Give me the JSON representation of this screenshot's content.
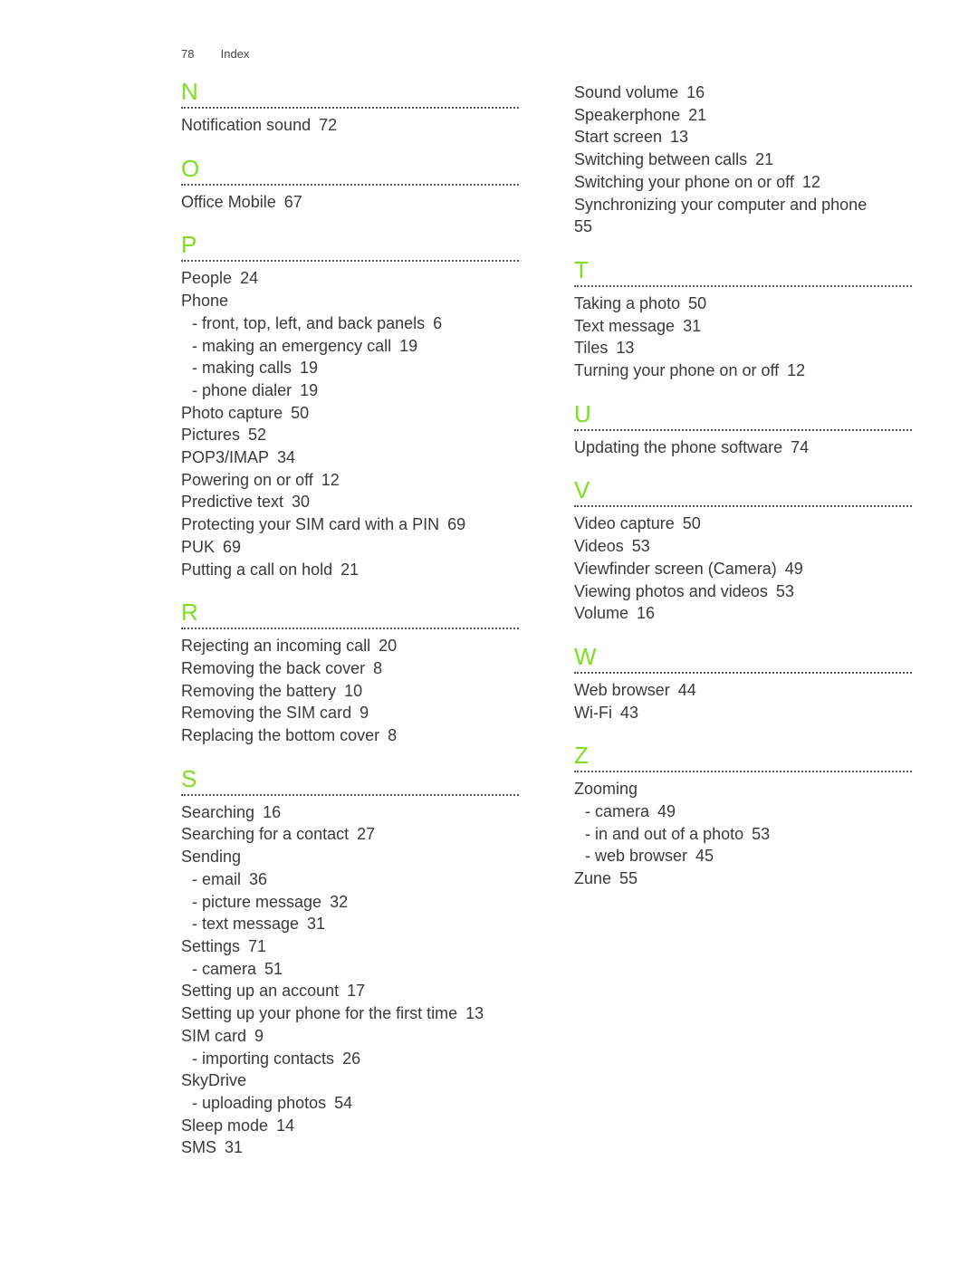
{
  "header": {
    "page_number": "78",
    "title": "Index"
  },
  "accent_color": "#7ddf1f",
  "columns": [
    {
      "sections": [
        {
          "letter": "N",
          "entries": [
            {
              "text": "Notification sound",
              "page": "72",
              "sub": false
            }
          ]
        },
        {
          "letter": "O",
          "entries": [
            {
              "text": "Office Mobile",
              "page": "67",
              "sub": false
            }
          ]
        },
        {
          "letter": "P",
          "entries": [
            {
              "text": "People",
              "page": "24",
              "sub": false
            },
            {
              "text": "Phone",
              "page": "",
              "sub": false
            },
            {
              "text": "- front, top, left, and back panels",
              "page": "6",
              "sub": true
            },
            {
              "text": "- making an emergency call",
              "page": "19",
              "sub": true
            },
            {
              "text": "- making calls",
              "page": "19",
              "sub": true
            },
            {
              "text": "- phone dialer",
              "page": "19",
              "sub": true
            },
            {
              "text": "Photo capture",
              "page": "50",
              "sub": false
            },
            {
              "text": "Pictures",
              "page": "52",
              "sub": false
            },
            {
              "text": "POP3/IMAP",
              "page": "34",
              "sub": false
            },
            {
              "text": "Powering on or off",
              "page": "12",
              "sub": false
            },
            {
              "text": "Predictive text",
              "page": "30",
              "sub": false
            },
            {
              "text": "Protecting your SIM card with a PIN",
              "page": "69",
              "sub": false
            },
            {
              "text": "PUK",
              "page": "69",
              "sub": false
            },
            {
              "text": "Putting a call on hold",
              "page": "21",
              "sub": false
            }
          ]
        },
        {
          "letter": "R",
          "entries": [
            {
              "text": "Rejecting an incoming call",
              "page": "20",
              "sub": false
            },
            {
              "text": "Removing the back cover",
              "page": "8",
              "sub": false
            },
            {
              "text": "Removing the battery",
              "page": "10",
              "sub": false
            },
            {
              "text": "Removing the SIM card",
              "page": "9",
              "sub": false
            },
            {
              "text": "Replacing the bottom cover",
              "page": "8",
              "sub": false
            }
          ]
        },
        {
          "letter": "S",
          "entries": [
            {
              "text": "Searching",
              "page": "16",
              "sub": false
            },
            {
              "text": "Searching for a contact",
              "page": "27",
              "sub": false
            },
            {
              "text": "Sending",
              "page": "",
              "sub": false
            },
            {
              "text": "- email",
              "page": "36",
              "sub": true
            },
            {
              "text": "- picture message",
              "page": "32",
              "sub": true
            },
            {
              "text": "- text message",
              "page": "31",
              "sub": true
            },
            {
              "text": "Settings",
              "page": "71",
              "sub": false
            },
            {
              "text": "- camera",
              "page": "51",
              "sub": true
            },
            {
              "text": "Setting up an account",
              "page": "17",
              "sub": false
            },
            {
              "text": "Setting up your phone for the first time",
              "page": "13",
              "sub": false
            },
            {
              "text": "SIM card",
              "page": "9",
              "sub": false
            },
            {
              "text": "- importing contacts",
              "page": "26",
              "sub": true
            },
            {
              "text": "SkyDrive",
              "page": "",
              "sub": false
            },
            {
              "text": "- uploading photos",
              "page": "54",
              "sub": true
            },
            {
              "text": "Sleep mode",
              "page": "14",
              "sub": false
            },
            {
              "text": "SMS",
              "page": "31",
              "sub": false
            }
          ]
        }
      ]
    },
    {
      "sections": [
        {
          "letter": "",
          "entries": [
            {
              "text": "Sound volume",
              "page": "16",
              "sub": false
            },
            {
              "text": "Speakerphone",
              "page": "21",
              "sub": false
            },
            {
              "text": "Start screen",
              "page": "13",
              "sub": false
            },
            {
              "text": "Switching between calls",
              "page": "21",
              "sub": false
            },
            {
              "text": "Switching your phone on or off",
              "page": "12",
              "sub": false
            },
            {
              "text": "Synchronizing your computer and phone",
              "page": "55",
              "sub": false,
              "wrap": true
            }
          ]
        },
        {
          "letter": "T",
          "entries": [
            {
              "text": "Taking a photo",
              "page": "50",
              "sub": false
            },
            {
              "text": "Text message",
              "page": "31",
              "sub": false
            },
            {
              "text": "Tiles",
              "page": "13",
              "sub": false
            },
            {
              "text": "Turning your phone on or off",
              "page": "12",
              "sub": false
            }
          ]
        },
        {
          "letter": "U",
          "entries": [
            {
              "text": "Updating the phone software",
              "page": "74",
              "sub": false
            }
          ]
        },
        {
          "letter": "V",
          "entries": [
            {
              "text": "Video capture",
              "page": "50",
              "sub": false
            },
            {
              "text": "Videos",
              "page": "53",
              "sub": false
            },
            {
              "text": "Viewfinder screen (Camera)",
              "page": "49",
              "sub": false
            },
            {
              "text": "Viewing photos and videos",
              "page": "53",
              "sub": false
            },
            {
              "text": "Volume",
              "page": "16",
              "sub": false
            }
          ]
        },
        {
          "letter": "W",
          "entries": [
            {
              "text": "Web browser",
              "page": "44",
              "sub": false
            },
            {
              "text": "Wi-Fi",
              "page": "43",
              "sub": false
            }
          ]
        },
        {
          "letter": "Z",
          "entries": [
            {
              "text": "Zooming",
              "page": "",
              "sub": false
            },
            {
              "text": "- camera",
              "page": "49",
              "sub": true
            },
            {
              "text": "- in and out of a photo",
              "page": "53",
              "sub": true
            },
            {
              "text": "- web browser",
              "page": "45",
              "sub": true
            },
            {
              "text": "Zune",
              "page": "55",
              "sub": false
            }
          ]
        }
      ]
    }
  ]
}
